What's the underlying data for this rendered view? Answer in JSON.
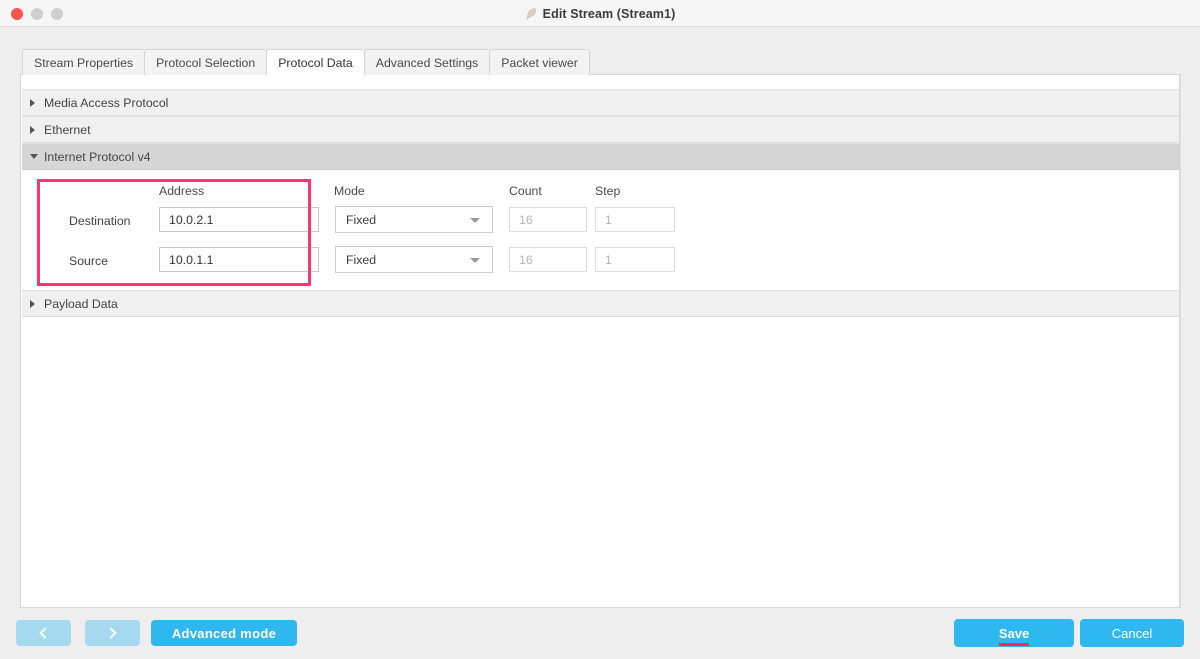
{
  "window": {
    "title": "Edit Stream (Stream1)",
    "title_icon": "feather-icon",
    "controls": {
      "close": "close-button",
      "minimize": "minimize-button",
      "maximize": "maximize-button"
    }
  },
  "tabs": [
    {
      "label": "Stream Properties",
      "active": false
    },
    {
      "label": "Protocol Selection",
      "active": false
    },
    {
      "label": "Protocol Data",
      "active": true
    },
    {
      "label": "Advanced Settings",
      "active": false
    },
    {
      "label": "Packet viewer",
      "active": false
    }
  ],
  "accordion": [
    {
      "label": "Media Access Protocol",
      "expanded": false
    },
    {
      "label": "Ethernet",
      "expanded": false
    },
    {
      "label": "Internet Protocol v4",
      "expanded": true
    },
    {
      "label": "Payload Data",
      "expanded": false
    }
  ],
  "ipv4": {
    "columns": {
      "address": "Address",
      "mode": "Mode",
      "count": "Count",
      "step": "Step"
    },
    "rows": [
      {
        "label": "Destination",
        "address": "10.0.2.1",
        "mode": "Fixed",
        "count": "16",
        "step": "1",
        "count_disabled": true,
        "step_disabled": true
      },
      {
        "label": "Source",
        "address": "10.0.1.1",
        "mode": "Fixed",
        "count": "16",
        "step": "1",
        "count_disabled": true,
        "step_disabled": true
      }
    ],
    "mode_options": [
      "Fixed"
    ]
  },
  "footer": {
    "prev_label": "",
    "next_label": "",
    "advanced_mode": "Advanced mode",
    "save": "Save",
    "cancel": "Cancel"
  },
  "annotations": {
    "highlight_box_color": "#f9366e",
    "save_underline_color": "#f5285e"
  },
  "colors": {
    "accent": "#2eb8ef",
    "nav_button": "#a5d9ef",
    "expanded_header": "#d6d6d6",
    "collapsed_header": "#f0f0f0",
    "close_dot": "#f7564a"
  }
}
